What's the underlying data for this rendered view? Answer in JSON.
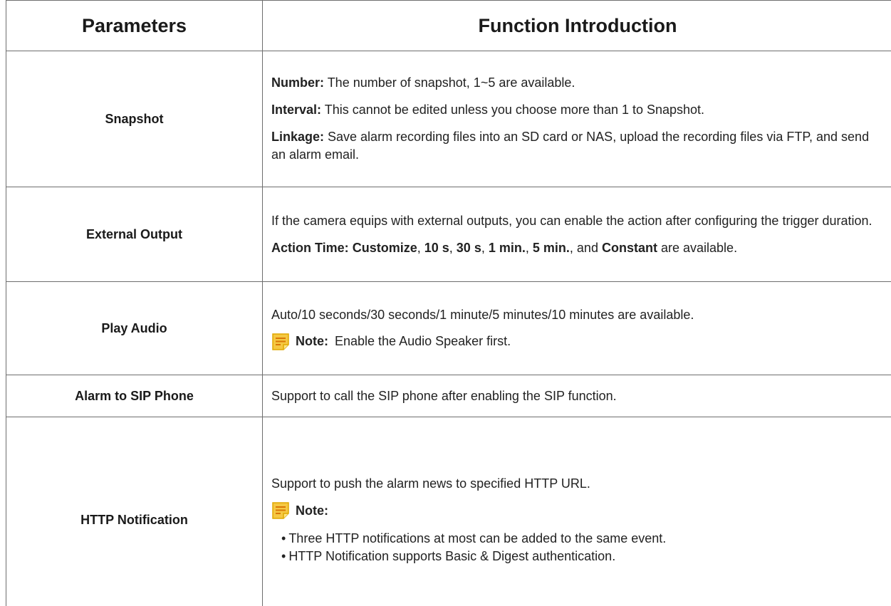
{
  "table": {
    "headers": {
      "parameters": "Parameters",
      "function": "Function Introduction"
    },
    "rows": {
      "snapshot": {
        "param": "Snapshot",
        "number_label": "Number:",
        "number_text": " The number of snapshot, 1~5 are available.",
        "interval_label": "Interval:",
        "interval_text": " This cannot be edited unless you choose more than 1 to Snapshot.",
        "linkage_label": "Linkage:",
        "linkage_text": " Save alarm recording files into an SD card or NAS, upload the recording files via FTP, and send an alarm email."
      },
      "external_output": {
        "param": "External Output",
        "intro": "If the camera equips with external outputs, you can enable the action after configuring the trigger duration.",
        "action_label": "Action Time:",
        "opt_customize": "Customize",
        "opt_10s": "10 s",
        "opt_30s": "30 s",
        "opt_1min": "1 min.",
        "opt_5min": "5 min.",
        "and": "and",
        "opt_constant": "Constant",
        "suffix": "are available."
      },
      "play_audio": {
        "param": "Play Audio",
        "text": "Auto/10 seconds/30 seconds/1 minute/5 minutes/10 minutes are available.",
        "note_label": "Note:",
        "note_text": "Enable the Audio Speaker first."
      },
      "sip_phone": {
        "param": "Alarm to SIP Phone",
        "text": "Support to call the SIP phone after enabling the SIP function."
      },
      "http_notification": {
        "param": "HTTP Notification",
        "text": "Support to push the alarm news to specified HTTP URL.",
        "note_label": "Note:",
        "bullets": [
          "Three HTTP notifications at most can be added to the same event.",
          "HTTP Notification supports Basic & Digest authentication."
        ]
      }
    }
  },
  "colors": {
    "border": "#6e6e6e",
    "note_icon_fill": "#f5c842",
    "note_icon_border": "#e0a800",
    "note_icon_lines": "#d97706"
  },
  "icons": {
    "note": "note-icon"
  }
}
